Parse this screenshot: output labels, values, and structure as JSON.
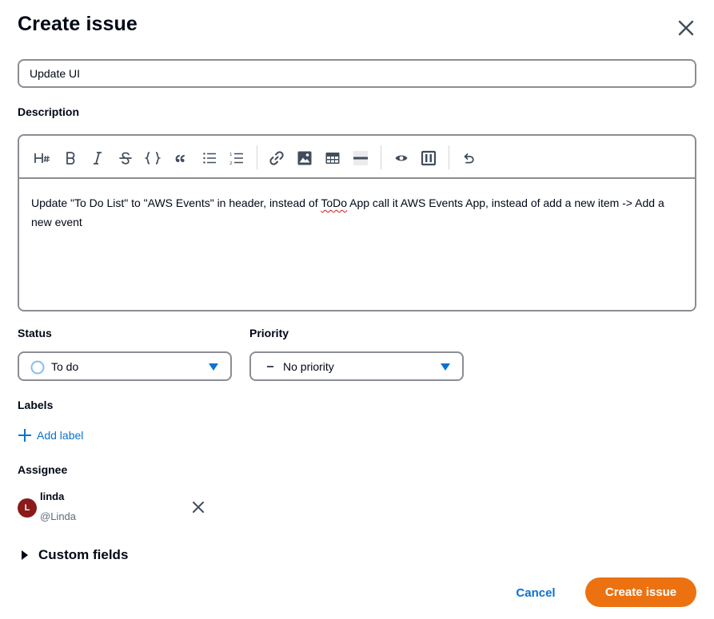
{
  "dialog": {
    "title": "Create issue"
  },
  "title_input": {
    "value": "Update UI"
  },
  "description": {
    "label": "Description",
    "text_before": "Update \"To Do List\" to \"AWS Events\" in header, instead of ",
    "misspelled": "ToDo",
    "text_after": " App call it AWS Events App, instead of add a new item -> Add a new event"
  },
  "toolbar": {
    "icons": [
      "heading-icon",
      "bold-icon",
      "italic-icon",
      "strikethrough-icon",
      "code-icon",
      "quote-icon",
      "bullet-list-icon",
      "numbered-list-icon",
      "link-icon",
      "image-icon",
      "table-icon",
      "horizontal-rule-icon",
      "preview-icon",
      "split-view-icon",
      "undo-icon"
    ]
  },
  "status": {
    "label": "Status",
    "value": "To do"
  },
  "priority": {
    "label": "Priority",
    "value": "No priority"
  },
  "labels": {
    "label": "Labels",
    "add_text": "Add label"
  },
  "assignee": {
    "label": "Assignee",
    "initial": "L",
    "name": "linda",
    "handle": "@Linda",
    "avatar_color": "#8b1a1a"
  },
  "custom_fields": {
    "label": "Custom fields"
  },
  "footer": {
    "cancel": "Cancel",
    "create": "Create issue"
  },
  "colors": {
    "accent": "#0972d3",
    "primary_button": "#ec7211"
  }
}
